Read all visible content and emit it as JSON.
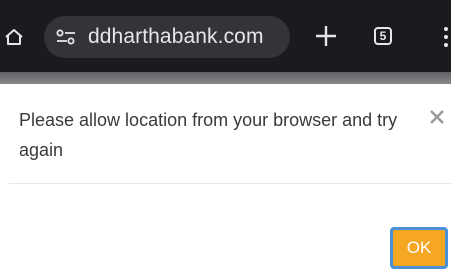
{
  "browser": {
    "url": "ddharthabank.com",
    "tab_count": "5",
    "icons": {
      "home": "home-icon",
      "site_settings": "site-settings-icon",
      "new_tab": "plus-icon",
      "tabs": "tab-switcher-icon",
      "menu": "more-vert-icon"
    }
  },
  "dialog": {
    "message": "Please allow location from your browser and try again",
    "close_icon": "close-icon",
    "ok_label": "OK",
    "ok_color": "#f5a623"
  }
}
